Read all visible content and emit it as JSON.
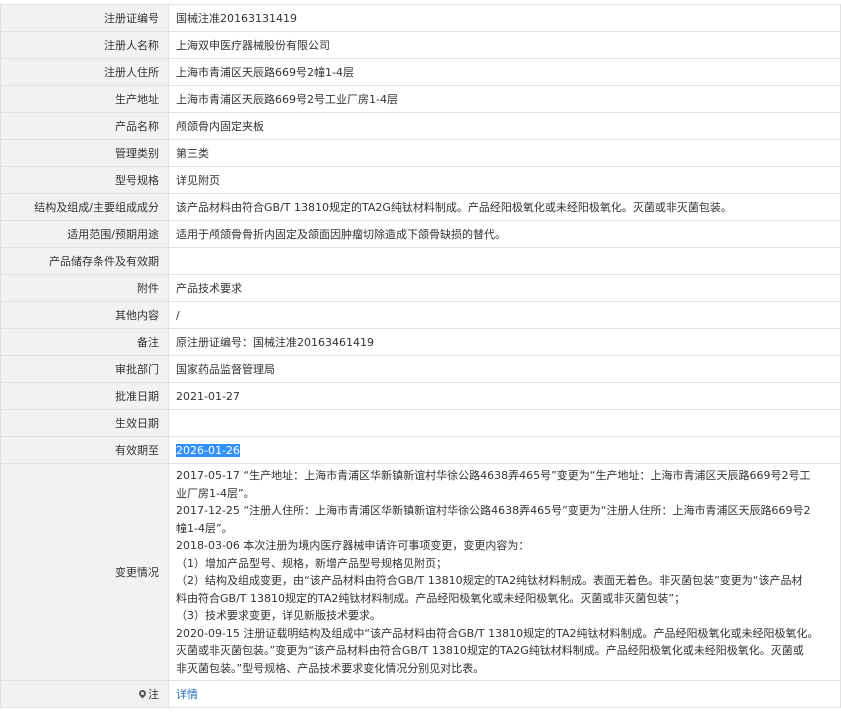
{
  "rows": [
    {
      "label": "注册证编号",
      "value": "国械注准20163131419"
    },
    {
      "label": "注册人名称",
      "value": "上海双申医疗器械股份有限公司"
    },
    {
      "label": "注册人住所",
      "value": "上海市青浦区天辰路669号2幢1-4层"
    },
    {
      "label": "生产地址",
      "value": "上海市青浦区天辰路669号2号工业厂房1-4层"
    },
    {
      "label": "产品名称",
      "value": "颅颌骨内固定夹板"
    },
    {
      "label": "管理类别",
      "value": "第三类"
    },
    {
      "label": "型号规格",
      "value": "详见附页"
    },
    {
      "label": "结构及组成/主要组成成分",
      "value": "该产品材料由符合GB/T 13810规定的TA2G纯钛材料制成。产品经阳极氧化或未经阳极氧化。灭菌或非灭菌包装。"
    },
    {
      "label": "适用范围/预期用途",
      "value": "适用于颅颌骨骨折内固定及颌面因肿瘤切除造成下颌骨缺损的替代。"
    },
    {
      "label": "产品储存条件及有效期",
      "value": ""
    },
    {
      "label": "附件",
      "value": "产品技术要求"
    },
    {
      "label": "其他内容",
      "value": "/"
    },
    {
      "label": "备注",
      "value": "原注册证编号：国械注准20163461419"
    },
    {
      "label": "审批部门",
      "value": "国家药品监督管理局"
    },
    {
      "label": "批准日期",
      "value": "2021-01-27"
    },
    {
      "label": "生效日期",
      "value": ""
    },
    {
      "label": "有效期至",
      "value": "2026-01-26"
    }
  ],
  "changes": {
    "label": "变更情况",
    "lines": [
      "2017-05-17 “生产地址：上海市青浦区华新镇新谊村华徐公路4638弄465号”变更为“生产地址：上海市青浦区天辰路669号2号工",
      "业厂房1-4层”。",
      "2017-12-25 “注册人住所：上海市青浦区华新镇新谊村华徐公路4638弄465号”变更为“注册人住所：上海市青浦区天辰路669号2",
      "幢1-4层”。",
      "2018-03-06 本次注册为境内医疗器械申请许可事项变更，变更内容为：",
      "（1）增加产品型号、规格，新增产品型号规格见附页；",
      "（2）结构及组成变更，由“该产品材料由符合GB/T 13810规定的TA2纯钛材料制成。表面无着色。非灭菌包装”变更为“该产品材",
      "料由符合GB/T 13810规定的TA2纯钛材料制成。产品经阳极氧化或未经阳极氧化。灭菌或非灭菌包装”；",
      "（3）技术要求变更，详见新版技术要求。",
      "2020-09-15 注册证载明结构及组成中“该产品材料由符合GB/T 13810规定的TA2纯钛材料制成。产品经阳极氧化或未经阳极氧化。",
      "灭菌或非灭菌包装。”变更为“该产品材料由符合GB/T 13810规定的TA2G纯钛材料制成。产品经阳极氧化或未经阳极氧化。灭菌或",
      "非灭菌包装。”型号规格、产品技术要求变化情况分别见对比表。"
    ]
  },
  "note": {
    "label": "注",
    "link": "详情"
  },
  "icons": {
    "note": "pin-icon"
  }
}
